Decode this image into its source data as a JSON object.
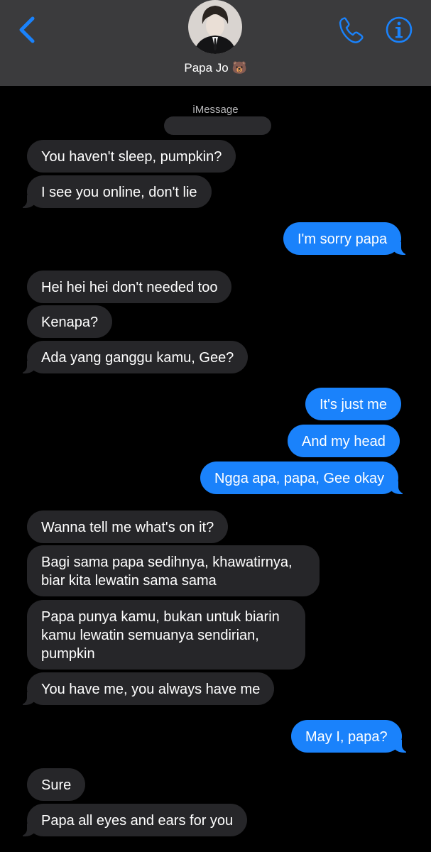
{
  "header": {
    "contact_name": "Papa Jo 🐻",
    "back_icon": "chevron-left-icon",
    "call_icon": "phone-icon",
    "info_icon": "info-icon",
    "accent": "#1a82fb",
    "background": "#3b3b3d"
  },
  "thread": {
    "service_label": "iMessage",
    "messages": [
      {
        "from": "them",
        "text": "You haven't sleep, pumpkin?"
      },
      {
        "from": "them",
        "text": "I see you online, don't lie"
      },
      {
        "from": "me",
        "text": "I'm sorry papa"
      },
      {
        "from": "them",
        "text": "Hei hei hei don't needed too"
      },
      {
        "from": "them",
        "text": "Kenapa?"
      },
      {
        "from": "them",
        "text": "Ada yang ganggu kamu, Gee?"
      },
      {
        "from": "me",
        "text": "It's just me"
      },
      {
        "from": "me",
        "text": "And my head"
      },
      {
        "from": "me",
        "text": "Ngga apa, papa, Gee okay"
      },
      {
        "from": "them",
        "text": "Wanna tell me what's on it?"
      },
      {
        "from": "them",
        "text": "Bagi sama papa sedihnya, khawatirnya, biar kita lewatin sama sama"
      },
      {
        "from": "them",
        "text": "Papa punya kamu, bukan untuk biarin kamu lewatin semuanya sendirian, pumpkin"
      },
      {
        "from": "them",
        "text": "You have me, you always have me"
      },
      {
        "from": "me",
        "text": "May I, papa?"
      },
      {
        "from": "them",
        "text": "Sure"
      },
      {
        "from": "them",
        "text": "Papa all eyes and ears for you"
      }
    ]
  }
}
